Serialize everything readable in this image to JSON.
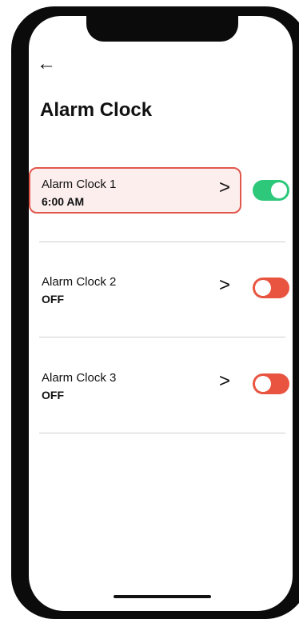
{
  "header": {
    "back_icon": "arrow-left-icon",
    "back_glyph": "←",
    "title": "Alarm Clock"
  },
  "alarms": [
    {
      "name": "Alarm Clock 1",
      "value": "6:00 AM",
      "enabled": true,
      "selected": true
    },
    {
      "name": "Alarm Clock 2",
      "value": "OFF",
      "enabled": false,
      "selected": false
    },
    {
      "name": "Alarm Clock 3",
      "value": "OFF",
      "enabled": false,
      "selected": false
    }
  ],
  "chevron_glyph": ">",
  "colors": {
    "toggle_on": "#2ec87a",
    "toggle_off": "#e8543f",
    "selected_border": "#e2574c",
    "selected_fill": "#fdeeee"
  }
}
